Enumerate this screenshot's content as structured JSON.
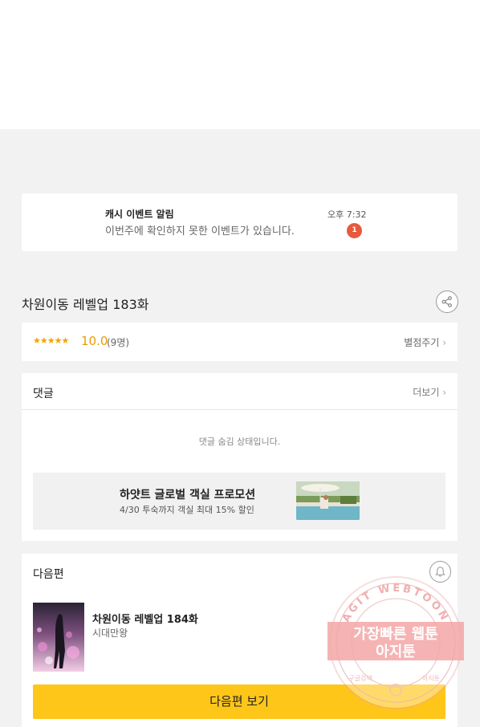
{
  "notification": {
    "title": "캐시 이벤트 알림",
    "message": "이번주에 확인하지 못한 이벤트가 있습니다.",
    "time": "오후 7:32",
    "badge_count": "1",
    "badge_color": "#e85a3c"
  },
  "episode": {
    "title": "차원이동 레벨업 183화",
    "share_icon": "share-icon"
  },
  "rating": {
    "stars": "★★★★★",
    "score": "10.0",
    "votes": "(9명)",
    "rate_label": "별점주기",
    "accent_color": "#f0a500"
  },
  "comments": {
    "header": "댓글",
    "more_label": "더보기",
    "hidden_notice": "댓글 숨김 상태입니다."
  },
  "promo": {
    "title": "하얏트 글로벌 객실 프로모션",
    "subtitle": "4/30 투숙까지 객실 최대 15% 할인"
  },
  "next_episode": {
    "header": "다음편",
    "bell_icon": "bell-icon",
    "title": "차원이동 레벨업 184화",
    "author": "시대만왕",
    "button_label": "다음편 보기",
    "button_color": "#ffc61a"
  },
  "watermark": {
    "ring_text": "AGIT WEBTOON",
    "line1": "가장빠른 웹툰",
    "line2": "아지툰",
    "left_small": "구글검색",
    "right_small": "아지툰"
  }
}
